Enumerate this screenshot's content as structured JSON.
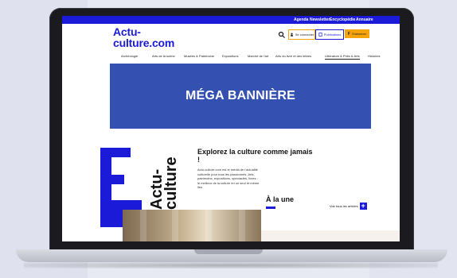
{
  "topbar": {
    "links": [
      "Agenda",
      "Newsletter",
      "Encyclopédie",
      "Annuaire"
    ]
  },
  "header": {
    "logo_line1": "Actu-",
    "logo_line2": "culture.com",
    "connect_label": "Se connecter",
    "publish_label": "Publications",
    "subscribe_label": "S'abonner"
  },
  "nav": {
    "items": [
      "Archéologie",
      "Arts de la scène",
      "Musées & Patrimoine",
      "Expositions",
      "Marché de l'art",
      "Arts du livre et des lettres",
      "Littérature & Philo & Arts",
      "Histoires"
    ]
  },
  "banner": {
    "text": "MÉGA BANNIÈRE"
  },
  "promo": {
    "vertical_line1": "Actu-",
    "vertical_line2": "culture",
    "title": "Explorez la culture comme jamais !",
    "body": "Actu-culture.com est le média de l'actualité culturelle pour tous les passionnés. Arts, patrimoine, expositions, spectacles, livres : le meilleur de la culture en un seul et même lieu."
  },
  "une": {
    "title": "À la une",
    "see_all": "Voir tous les articles",
    "plus": "+"
  },
  "colors": {
    "accent_blue": "#1a1ad8",
    "banner_blue": "#3451b2",
    "accent_orange": "#f5a40b"
  }
}
